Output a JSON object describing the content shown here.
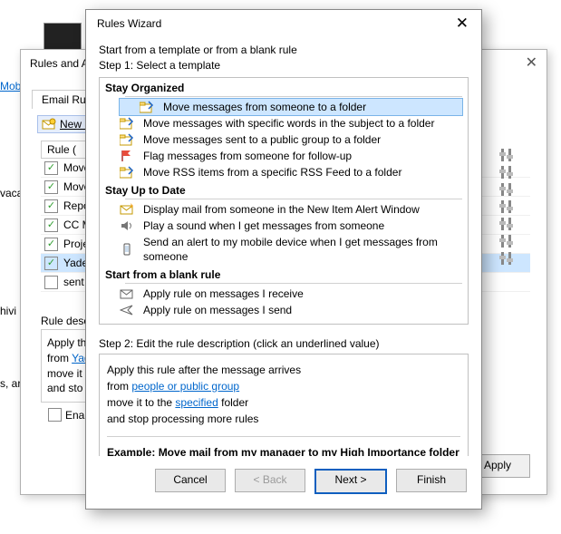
{
  "side": {
    "mob": "Mob",
    "vaca": "vaca",
    "hivi": "hivi",
    "sar": "s, ar"
  },
  "rules_alerts": {
    "title": "Rules and A",
    "tab_email": "Email Rule",
    "new_rule": "New R",
    "rule_header": "Rule (",
    "rows": [
      "Move",
      "Move",
      "Repor",
      "CC Ma",
      "Projec",
      "Yadel-",
      "sent o"
    ],
    "desc_label": "Rule descr",
    "desc_line1": "Apply th",
    "desc_from": "from",
    "desc_from_link": "Yad",
    "desc_line3": "move it t",
    "desc_line4": "and sto",
    "enable": "Enable",
    "apply": "Apply"
  },
  "wizard": {
    "title": "Rules Wizard",
    "intro_line1": "Start from a template or from a blank rule",
    "intro_line2": "Step 1: Select a template",
    "sections": {
      "stay_organized": "Stay Organized",
      "stay_uptodate": "Stay Up to Date",
      "from_blank": "Start from a blank rule"
    },
    "templates": {
      "t1": "Move messages from someone to a folder",
      "t2": "Move messages with specific words in the subject to a folder",
      "t3": "Move messages sent to a public group to a folder",
      "t4": "Flag messages from someone for follow-up",
      "t5": "Move RSS items from a specific RSS Feed to a folder",
      "t6": "Display mail from someone in the New Item Alert Window",
      "t7": "Play a sound when I get messages from someone",
      "t8": "Send an alert to my mobile device when I get messages from someone",
      "t9": "Apply rule on messages I receive",
      "t10": "Apply rule on messages I send"
    },
    "step2_intro": "Step 2: Edit the rule description (click an underlined value)",
    "desc": {
      "line1": "Apply this rule after the message arrives",
      "from_prefix": "from",
      "from_link": "people or public group",
      "move_prefix": "move it to the",
      "move_link": "specified",
      "move_suffix": "folder",
      "stop": " and stop processing more rules",
      "example": "Example: Move mail from my manager to my High Importance folder"
    },
    "buttons": {
      "cancel": "Cancel",
      "back": "< Back",
      "next": "Next >",
      "finish": "Finish"
    }
  }
}
